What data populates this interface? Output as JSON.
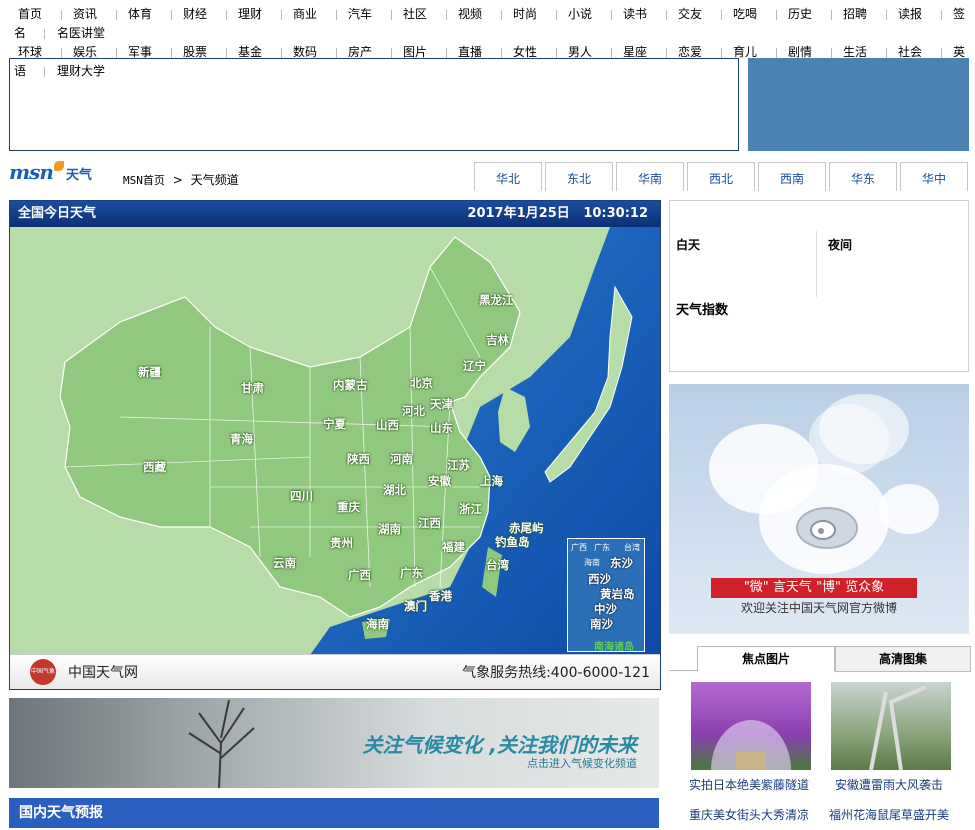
{
  "nav": {
    "row1": [
      "首页",
      "资讯",
      "体育",
      "财经",
      "理财",
      "商业",
      "汽车",
      "社区",
      "视频",
      "时尚",
      "小说",
      "读书",
      "交友",
      "吃喝",
      "历史",
      "招聘",
      "读报",
      "签"
    ],
    "row1_wrap": "名",
    "row1_wrap_item": "名医讲堂",
    "row2": [
      "环球",
      "娱乐",
      "军事",
      "股票",
      "基金",
      "数码",
      "房产",
      "图片",
      "直播",
      "女性",
      "男人",
      "星座",
      "恋爱",
      "育儿",
      "剧情",
      "生活",
      "社会",
      "英"
    ],
    "row3_wrap": "语",
    "row3_item": "理财大学"
  },
  "logo": {
    "brand": "msn",
    "section": "天气"
  },
  "breadcrumb": {
    "home": "MSN首页",
    "sep": ">",
    "current": "天气频道"
  },
  "region_tabs": [
    "华北",
    "东北",
    "华南",
    "西北",
    "西南",
    "华东",
    "华中"
  ],
  "map": {
    "title": "全国今日天气",
    "date": "2017年1月25日",
    "time": "10:30:12",
    "provinces": [
      {
        "name": "黑龙江"
      },
      {
        "name": "吉林"
      },
      {
        "name": "辽宁"
      },
      {
        "name": "新疆"
      },
      {
        "name": "内蒙古"
      },
      {
        "name": "甘肃"
      },
      {
        "name": "北京"
      },
      {
        "name": "天津"
      },
      {
        "name": "河北"
      },
      {
        "name": "宁夏"
      },
      {
        "name": "山西"
      },
      {
        "name": "山东"
      },
      {
        "name": "青海"
      },
      {
        "name": "陕西"
      },
      {
        "name": "河南"
      },
      {
        "name": "西藏"
      },
      {
        "name": "江苏"
      },
      {
        "name": "安徽"
      },
      {
        "name": "上海"
      },
      {
        "name": "四川"
      },
      {
        "name": "湖北"
      },
      {
        "name": "重庆"
      },
      {
        "name": "浙江"
      },
      {
        "name": "湖南"
      },
      {
        "name": "江西"
      },
      {
        "name": "赤尾屿"
      },
      {
        "name": "贵州"
      },
      {
        "name": "钓鱼岛"
      },
      {
        "name": "福建"
      },
      {
        "name": "云南"
      },
      {
        "name": "台湾"
      },
      {
        "name": "广西"
      },
      {
        "name": "广东"
      },
      {
        "name": "香港"
      },
      {
        "name": "澳门"
      },
      {
        "name": "海南"
      }
    ],
    "inset": {
      "labels": [
        "东沙",
        "西沙",
        "黄岩岛",
        "中沙",
        "南沙",
        "南海诸岛"
      ],
      "small": [
        "广西",
        "广东",
        "台湾",
        "海南"
      ]
    },
    "footer_name": "中国天气网",
    "footer_seal": "中国气象",
    "hotline": "气象服务热线:400-6000-121"
  },
  "banner": {
    "headline": "关注气候变化 ,关注我们的未来",
    "sub": "点击进入气候变化频道"
  },
  "section_title": "国内天气预报",
  "forecast": {
    "day": "白天",
    "night": "夜间",
    "index_title": "天气指数"
  },
  "weibo": {
    "slogan": "\"微\" 言天气  \"博\" 览众象",
    "caption": "欢迎关注中国天气网官方微博"
  },
  "photo_tabs": [
    "焦点图片",
    "高清图集"
  ],
  "photos": [
    {
      "caption": "实拍日本绝美紫藤隧道"
    },
    {
      "caption": "安徽遭雷雨大风袭击"
    },
    {
      "caption": "重庆美女街头大秀清凉"
    },
    {
      "caption": "福州花海鼠尾草盛开美"
    }
  ],
  "colors": {
    "accent": "#2b5fbf",
    "map_land": "#8fc87e",
    "map_sea": "#1456b0",
    "red": "#d0212a"
  }
}
